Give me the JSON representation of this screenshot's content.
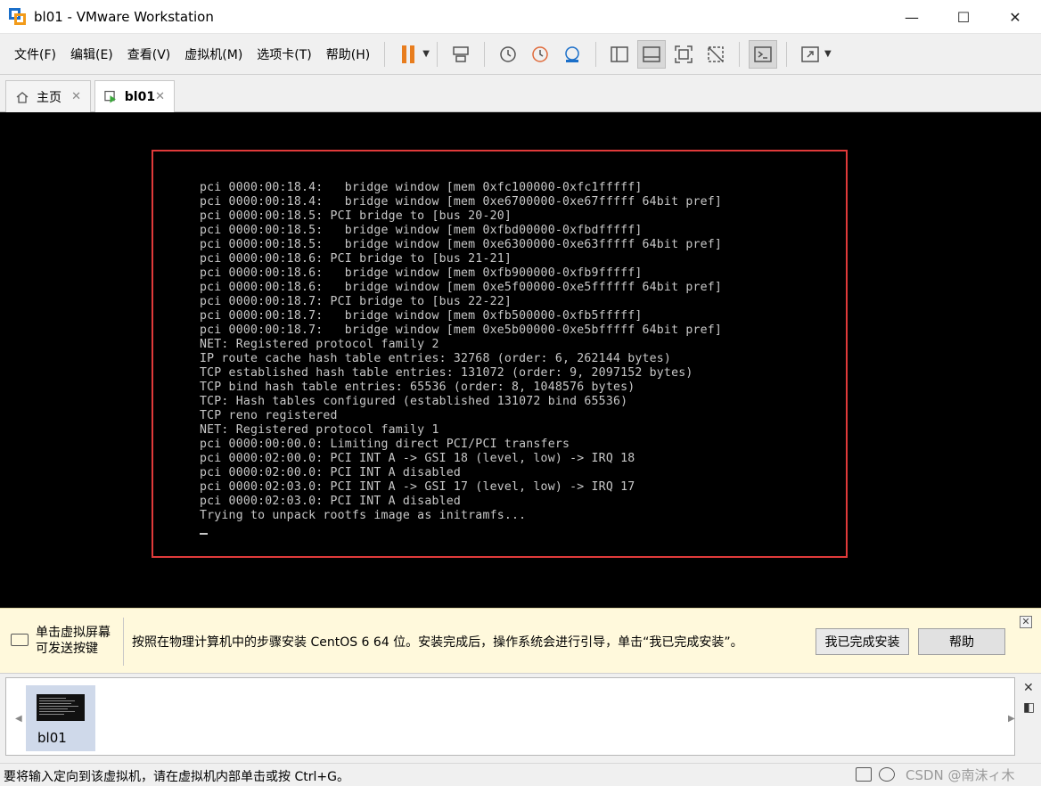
{
  "window": {
    "title": "bl01 - VMware Workstation",
    "minimize": "—",
    "maximize": "☐",
    "close": "✕"
  },
  "menu": [
    "文件(F)",
    "编辑(E)",
    "查看(V)",
    "虚拟机(M)",
    "选项卡(T)",
    "帮助(H)"
  ],
  "toolbar": {
    "icons": [
      "pause-icon",
      "send-ctrl-alt-del-icon",
      "snapshot-icon",
      "revert-snapshot-icon",
      "snapshot-manager-icon",
      "library-view-icon",
      "thumbnail-view-icon",
      "fullscreen-icon",
      "unity-icon",
      "console-view-icon",
      "stretch-icon"
    ],
    "pause_color": "#e87d1e"
  },
  "tabs": [
    {
      "label": "主页",
      "icon": "home-icon",
      "close": "✕",
      "active": false
    },
    {
      "label": "bl01",
      "icon": "vm-play-icon",
      "close": "✕",
      "active": true
    }
  ],
  "console": {
    "lines": [
      "pci 0000:00:18.4:   bridge window [mem 0xfc100000-0xfc1fffff]",
      "pci 0000:00:18.4:   bridge window [mem 0xe6700000-0xe67fffff 64bit pref]",
      "pci 0000:00:18.5: PCI bridge to [bus 20-20]",
      "pci 0000:00:18.5:   bridge window [mem 0xfbd00000-0xfbdfffff]",
      "pci 0000:00:18.5:   bridge window [mem 0xe6300000-0xe63fffff 64bit pref]",
      "pci 0000:00:18.6: PCI bridge to [bus 21-21]",
      "pci 0000:00:18.6:   bridge window [mem 0xfb900000-0xfb9fffff]",
      "pci 0000:00:18.6:   bridge window [mem 0xe5f00000-0xe5ffffff 64bit pref]",
      "pci 0000:00:18.7: PCI bridge to [bus 22-22]",
      "pci 0000:00:18.7:   bridge window [mem 0xfb500000-0xfb5fffff]",
      "pci 0000:00:18.7:   bridge window [mem 0xe5b00000-0xe5bfffff 64bit pref]",
      "NET: Registered protocol family 2",
      "IP route cache hash table entries: 32768 (order: 6, 262144 bytes)",
      "TCP established hash table entries: 131072 (order: 9, 2097152 bytes)",
      "TCP bind hash table entries: 65536 (order: 8, 1048576 bytes)",
      "TCP: Hash tables configured (established 131072 bind 65536)",
      "TCP reno registered",
      "NET: Registered protocol family 1",
      "pci 0000:00:00.0: Limiting direct PCI/PCI transfers",
      "pci 0000:02:00.0: PCI INT A -> GSI 18 (level, low) -> IRQ 18",
      "pci 0000:02:00.0: PCI INT A disabled",
      "pci 0000:02:03.0: PCI INT A -> GSI 17 (level, low) -> IRQ 17",
      "pci 0000:02:03.0: PCI INT A disabled",
      "Trying to unpack rootfs image as initramfs..."
    ],
    "highlight_color": "#e03a3a"
  },
  "hint": {
    "left_line1": "单击虚拟屏幕",
    "left_line2": "可发送按键",
    "message": "按照在物理计算机中的步骤安装 CentOS 6 64 位。安装完成后，操作系统会进行引导，单击“我已完成安装”。",
    "done_button": "我已完成安装",
    "help_button": "帮助",
    "close": "✕"
  },
  "thumbnails": {
    "items": [
      {
        "label": "bl01"
      }
    ],
    "left_arrow": "◀",
    "right_arrow": "▶",
    "close": "✕",
    "pin": "◧"
  },
  "status": {
    "text": "要将输入定向到该虚拟机，请在虚拟机内部单击或按 Ctrl+G。",
    "watermark": "CSDN @南沫ィ木"
  }
}
